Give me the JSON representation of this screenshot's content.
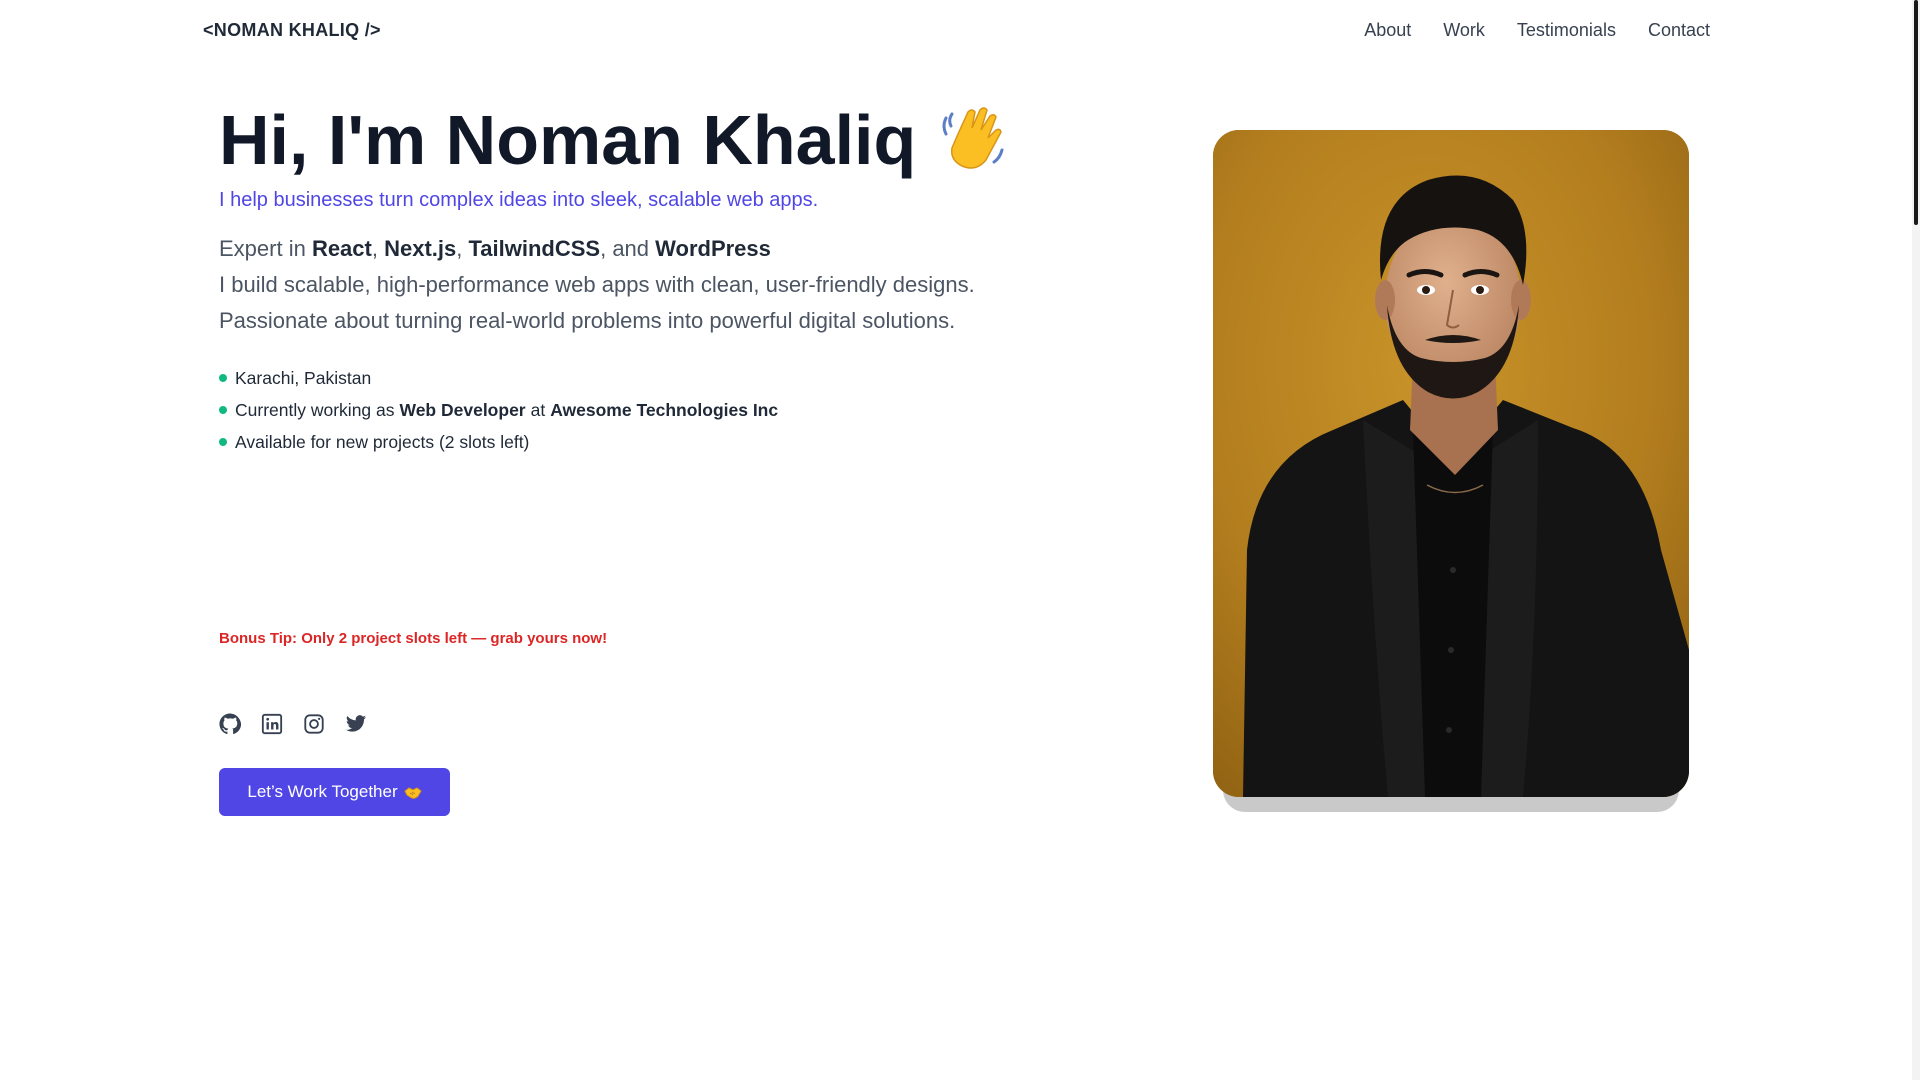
{
  "header": {
    "logo": "<NOMAN KHALIQ />",
    "nav": [
      "About",
      "Work",
      "Testimonials",
      "Contact"
    ]
  },
  "hero": {
    "title": "Hi, I'm Noman Khaliq",
    "title_emoji": "waving-hand-icon",
    "tagline": "I help businesses turn complex ideas into sleek, scalable web apps.",
    "expert": {
      "prefix": "Expert in ",
      "skills": [
        "React",
        "Next.js",
        "TailwindCSS",
        "WordPress"
      ],
      "sep1": ", ",
      "sep2": ", ",
      "sep3": ", and "
    },
    "line2": "I build scalable, high-performance web apps with clean, user-friendly designs.",
    "line3": "Passionate about turning real-world problems into powerful digital solutions.",
    "facts": {
      "location": "Karachi, Pakistan",
      "work_prefix": "Currently working as",
      "role": "Web Developer",
      "work_mid": "at",
      "company": "Awesome Technologies Inc",
      "availability": "Available for new projects (2 slots left)"
    },
    "bonus": "Bonus Tip: Only 2 project slots left — grab yours now!",
    "socials": [
      "github-icon",
      "linkedin-icon",
      "instagram-icon",
      "twitter-icon"
    ],
    "cta_label": "Let’s Work Together",
    "cta_emoji": "handshake-icon"
  },
  "colors": {
    "accent": "#4f46e5",
    "status_dot": "#10b981",
    "bonus": "#dc2626",
    "portrait_bg": "#b27d1e"
  }
}
